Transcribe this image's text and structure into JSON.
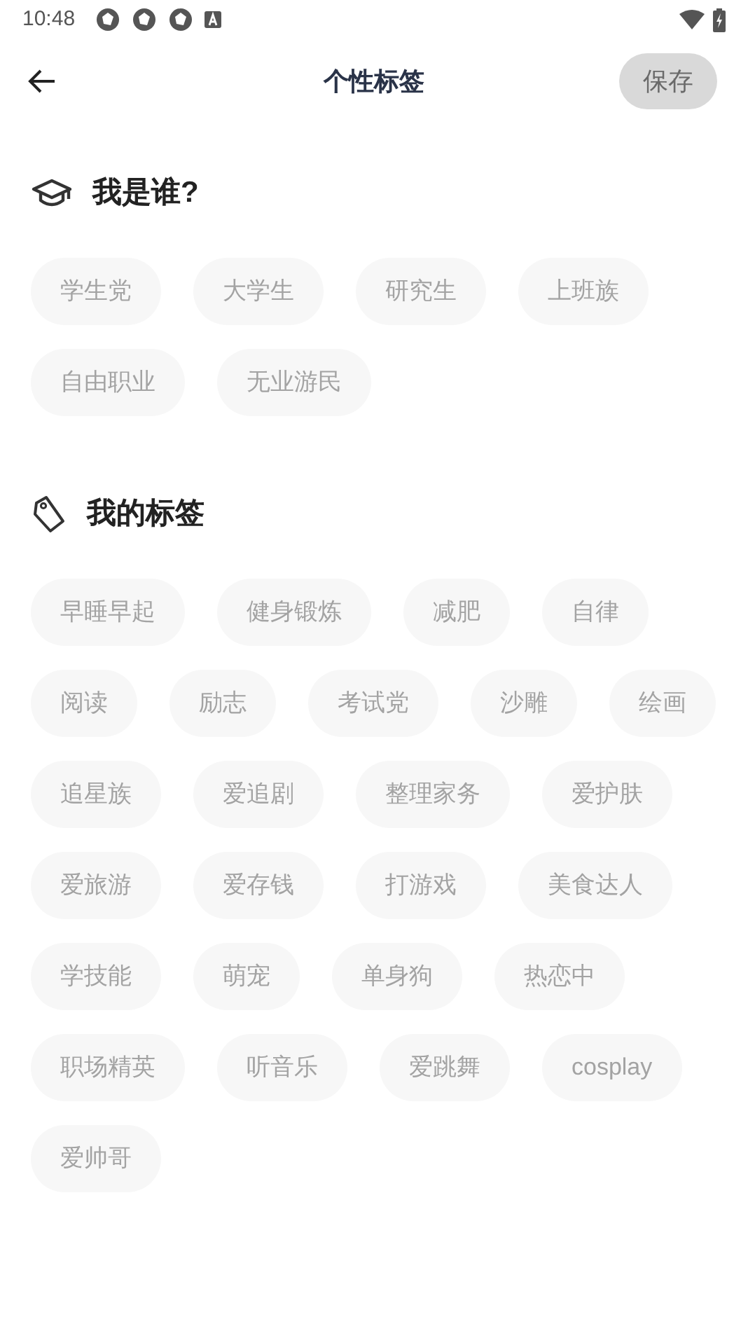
{
  "status_bar": {
    "time": "10:48"
  },
  "header": {
    "title": "个性标签",
    "save_button": "保存"
  },
  "sections": [
    {
      "kind": "identity",
      "title": "我是谁?",
      "tags": [
        {
          "label": "学生党",
          "selected": false
        },
        {
          "label": "大学生",
          "selected": false
        },
        {
          "label": "研究生",
          "selected": false
        },
        {
          "label": "上班族",
          "selected": false
        },
        {
          "label": "自由职业",
          "selected": false
        },
        {
          "label": "无业游民",
          "selected": false
        }
      ]
    },
    {
      "kind": "tags",
      "title": "我的标签",
      "tags": [
        {
          "label": "早睡早起",
          "selected": false
        },
        {
          "label": "健身锻炼",
          "selected": false
        },
        {
          "label": "减肥",
          "selected": false
        },
        {
          "label": "自律",
          "selected": false
        },
        {
          "label": "阅读",
          "selected": false
        },
        {
          "label": "励志",
          "selected": false
        },
        {
          "label": "考试党",
          "selected": false
        },
        {
          "label": "沙雕",
          "selected": false
        },
        {
          "label": "绘画",
          "selected": false
        },
        {
          "label": "追星族",
          "selected": false
        },
        {
          "label": "爱追剧",
          "selected": false
        },
        {
          "label": "整理家务",
          "selected": false
        },
        {
          "label": "爱护肤",
          "selected": false
        },
        {
          "label": "爱旅游",
          "selected": false
        },
        {
          "label": "爱存钱",
          "selected": false
        },
        {
          "label": "打游戏",
          "selected": false
        },
        {
          "label": "美食达人",
          "selected": false
        },
        {
          "label": "学技能",
          "selected": false
        },
        {
          "label": "萌宠",
          "selected": false
        },
        {
          "label": "单身狗",
          "selected": false
        },
        {
          "label": "热恋中",
          "selected": false
        },
        {
          "label": "职场精英",
          "selected": false
        },
        {
          "label": "听音乐",
          "selected": false
        },
        {
          "label": "爱跳舞",
          "selected": false
        },
        {
          "label": "cosplay",
          "selected": false
        },
        {
          "label": "爱帅哥",
          "selected": false
        }
      ]
    }
  ]
}
